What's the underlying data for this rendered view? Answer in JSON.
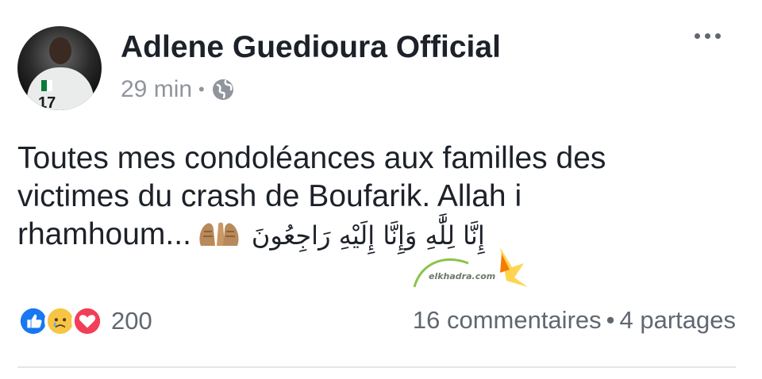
{
  "post": {
    "author": "Adlene Guedioura Official",
    "time": "29 min",
    "privacy_icon": "globe-icon",
    "text_lines": [
      "Toutes mes condoléances aux familles des",
      "victimes du crash de Boufarik. Allah i",
      "rhamhoum..."
    ],
    "emoji": "folded-hands",
    "arabic_text": "إِنَّا لِلَّٰهِ وَإِنَّا إِلَيْهِ رَاجِعُونَ",
    "avatar_jersey_number": "17"
  },
  "watermark": {
    "text": "elkhadra.com"
  },
  "engagement": {
    "reactions": [
      "like",
      "sad",
      "love"
    ],
    "reaction_count": "200",
    "comments": "16 commentaires",
    "shares": "4 partages",
    "separator": "•"
  },
  "colors": {
    "author": "#1d2129",
    "meta": "#90949c",
    "like": "#1877f2",
    "love": "#f33e58",
    "sad": "#f7c544"
  }
}
